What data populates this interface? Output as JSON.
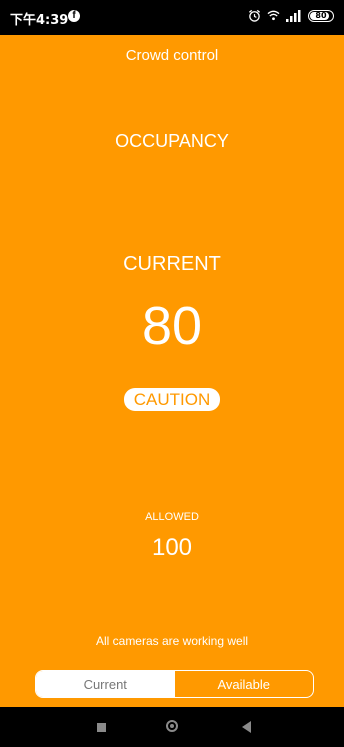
{
  "status_bar": {
    "time": "下午4:39",
    "icons": [
      "facebook-icon",
      "alarm-icon",
      "wifi-icon",
      "signal-icon"
    ],
    "battery_level": "80"
  },
  "app": {
    "title": "Crowd control",
    "heading": "OCCUPANCY",
    "current_label": "CURRENT",
    "current_value": "80",
    "status_badge": "CAUTION",
    "allowed_label": "ALLOWED",
    "allowed_value": "100",
    "camera_status": "All cameras are working well",
    "tabs": {
      "current": "Current",
      "available": "Available"
    },
    "colors": {
      "background": "#FF9900",
      "text": "#FFFFFF",
      "badge_background": "#FFFFFF",
      "badge_text": "#FF9900"
    }
  },
  "nav_bar": {
    "buttons": [
      "recent-apps",
      "home",
      "back"
    ]
  }
}
